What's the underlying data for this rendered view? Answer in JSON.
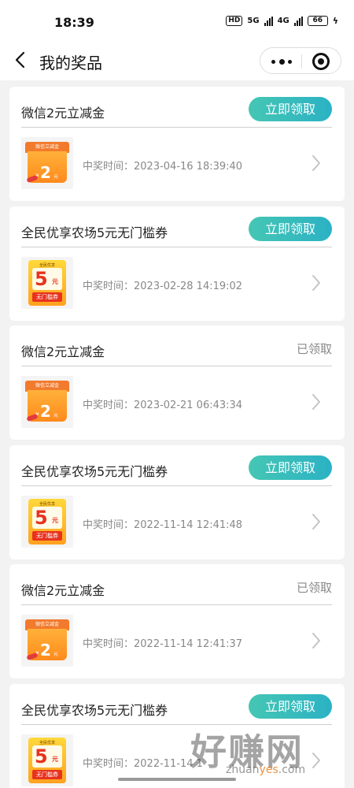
{
  "status_bar": {
    "time": "18:39",
    "hd": "HD",
    "net1": "5G",
    "net2": "4G",
    "battery": "66"
  },
  "nav": {
    "title": "我的奖品",
    "back_icon": "chevron-left-icon",
    "more_icon": "more-dots-icon",
    "target_icon": "target-icon"
  },
  "time_label": "中奖时间：",
  "cards": [
    {
      "title": "微信2元立减金",
      "action": "立即领取",
      "action_type": "button",
      "coupon": "wx",
      "time": "2023-04-16 18:39:40"
    },
    {
      "title": "全民优享农场5元无门槛券",
      "action": "立即领取",
      "action_type": "button",
      "coupon": "farm",
      "time": "2023-02-28 14:19:02"
    },
    {
      "title": "微信2元立减金",
      "action": "已领取",
      "action_type": "status",
      "coupon": "wx",
      "time": "2023-02-21 06:43:34"
    },
    {
      "title": "全民优享农场5元无门槛券",
      "action": "立即领取",
      "action_type": "button",
      "coupon": "farm",
      "time": "2022-11-14 12:41:48"
    },
    {
      "title": "微信2元立减金",
      "action": "已领取",
      "action_type": "status",
      "coupon": "wx",
      "time": "2022-11-14 12:41:37"
    },
    {
      "title": "全民优享农场5元无门槛券",
      "action": "立即领取",
      "action_type": "button",
      "coupon": "farm",
      "time": "2022-11-14 1"
    }
  ],
  "coupon_wx": {
    "tag": "微信立减金",
    "amount": "2",
    "symbol": "¥",
    "unit": "元"
  },
  "coupon_farm": {
    "top": "全民优享",
    "amount": "5",
    "unit": "元",
    "band": "无门槛券"
  },
  "watermark": {
    "big": "好赚网",
    "url_pre": "zhuan",
    "url_mid": "yes",
    "url_post": ".com"
  },
  "colors": {
    "accent_start": "#45c6b4",
    "accent_end": "#2bb2c4",
    "status_gray": "#888888"
  }
}
